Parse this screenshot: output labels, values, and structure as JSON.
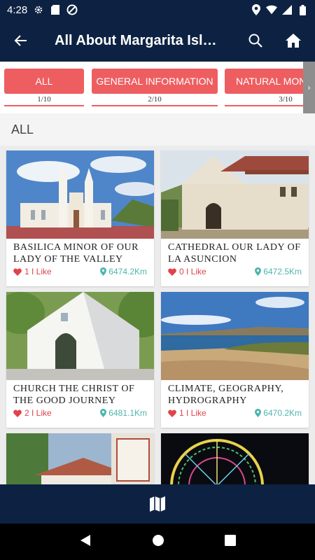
{
  "status_bar": {
    "time": "4:28"
  },
  "app_bar": {
    "title": "All About Margarita Island"
  },
  "tabs": [
    {
      "label": "ALL",
      "count": "1/10"
    },
    {
      "label": "GENERAL INFORMATION",
      "count": "2/10"
    },
    {
      "label": "NATURAL MONUMENTS",
      "count": "3/10"
    }
  ],
  "section": {
    "title": "ALL"
  },
  "cards": [
    {
      "name": "BASILICA MINOR OF OUR LADY OF THE VALLEY",
      "likes": "1 I Like",
      "distance": "6474.2Km"
    },
    {
      "name": "CATHEDRAL OUR LADY OF LA ASUNCION",
      "likes": "0 I Like",
      "distance": "6472.5Km"
    },
    {
      "name": "CHURCH THE CHRIST OF THE GOOD JOURNEY",
      "likes": "2 I Like",
      "distance": "6481.1Km"
    },
    {
      "name": "CLIMATE, GEOGRAPHY, HYDROGRAPHY",
      "likes": "1 I Like",
      "distance": "6470.2Km"
    },
    {
      "name": "",
      "likes": "",
      "distance": ""
    },
    {
      "name": "",
      "likes": "",
      "distance": ""
    }
  ],
  "colors": {
    "primary": "#0d2242",
    "accent": "#ee5e61",
    "like": "#e0434a",
    "distance": "#4db6ac"
  }
}
